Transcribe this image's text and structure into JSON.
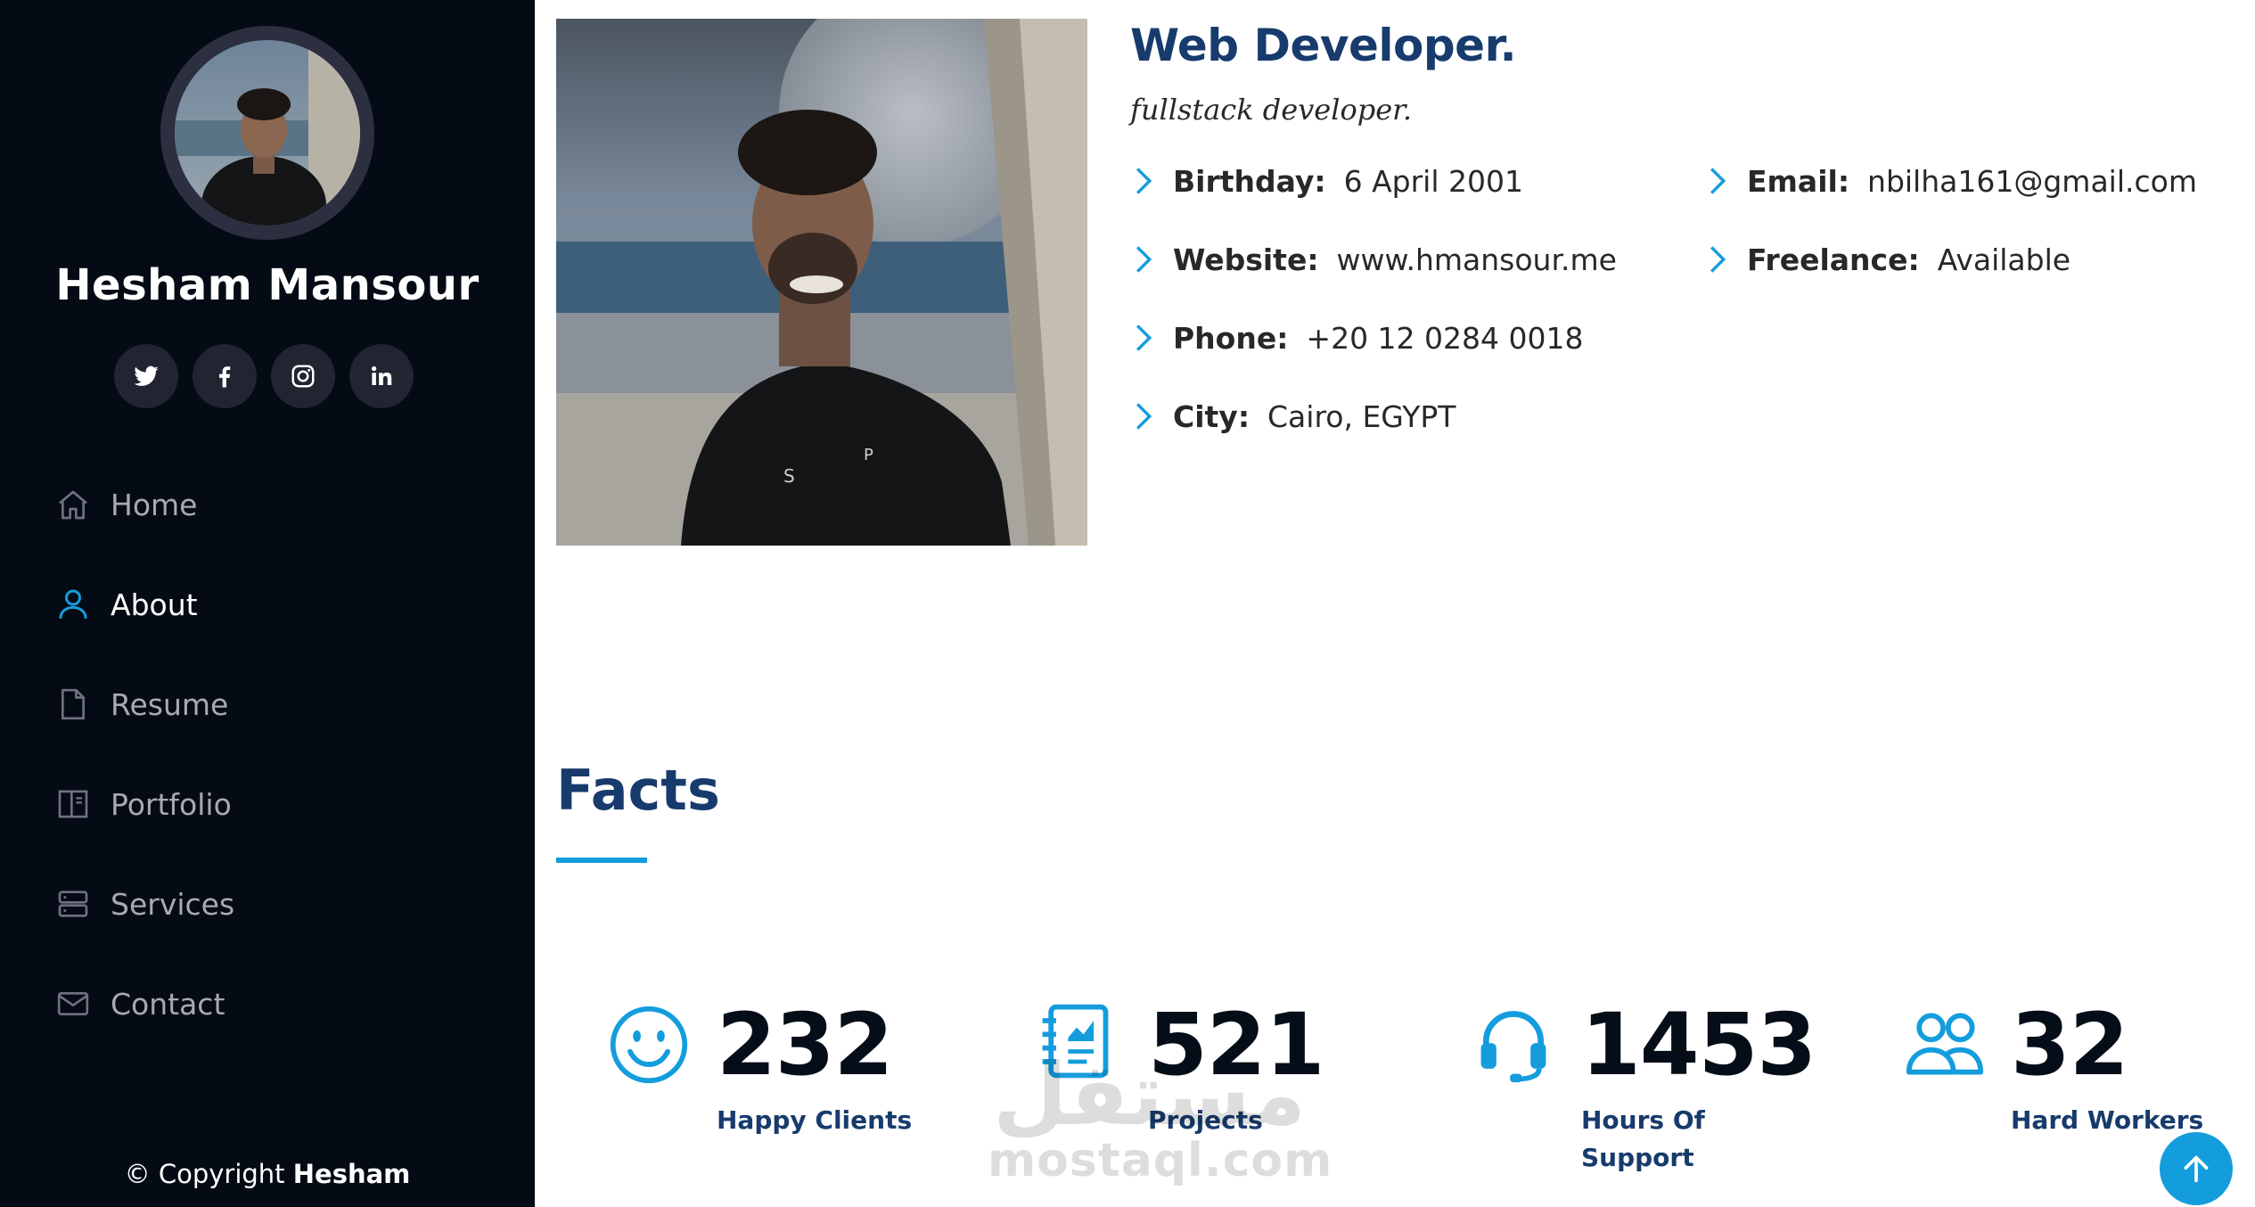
{
  "sidebar": {
    "profile_name": "Hesham Mansour",
    "social": [
      "twitter-icon",
      "facebook-icon",
      "instagram-icon",
      "linkedin-icon"
    ],
    "nav": [
      {
        "label": "Home",
        "icon": "home-icon",
        "active": false
      },
      {
        "label": "About",
        "icon": "person-icon",
        "active": true
      },
      {
        "label": "Resume",
        "icon": "file-icon",
        "active": false
      },
      {
        "label": "Portfolio",
        "icon": "book-icon",
        "active": false
      },
      {
        "label": "Services",
        "icon": "server-icon",
        "active": false
      },
      {
        "label": "Contact",
        "icon": "envelope-icon",
        "active": false
      }
    ],
    "copyright_prefix": "© Copyright",
    "copyright_name": "Hesham"
  },
  "about": {
    "title": "Web Developer.",
    "subtitle": "fullstack developer.",
    "left": [
      {
        "key": "Birthday:",
        "value": "6 April 2001"
      },
      {
        "key": "Website:",
        "value": "www.hmansour.me"
      },
      {
        "key": "Phone:",
        "value": "+20 12 0284 0018"
      },
      {
        "key": "City:",
        "value": "Cairo, EGYPT"
      }
    ],
    "right": [
      {
        "key": "Email:",
        "value": "nbilha161@gmail.com"
      },
      {
        "key": "Freelance:",
        "value": "Available"
      }
    ]
  },
  "facts": {
    "title": "Facts",
    "counters": [
      {
        "value": "232",
        "label": "Happy Clients",
        "icon": "smiley-icon"
      },
      {
        "value": "521",
        "label": "Projects",
        "icon": "journal-icon"
      },
      {
        "value": "1453",
        "label": "Hours Of Support",
        "icon": "headset-icon"
      },
      {
        "value": "32",
        "label": "Hard Workers",
        "icon": "people-icon"
      }
    ]
  },
  "watermark": {
    "arabic": "مستقل",
    "latin": "mostaql.com"
  },
  "colors": {
    "sidebar_bg": "#040b14",
    "accent": "#149ddd",
    "heading": "#173b6c"
  }
}
